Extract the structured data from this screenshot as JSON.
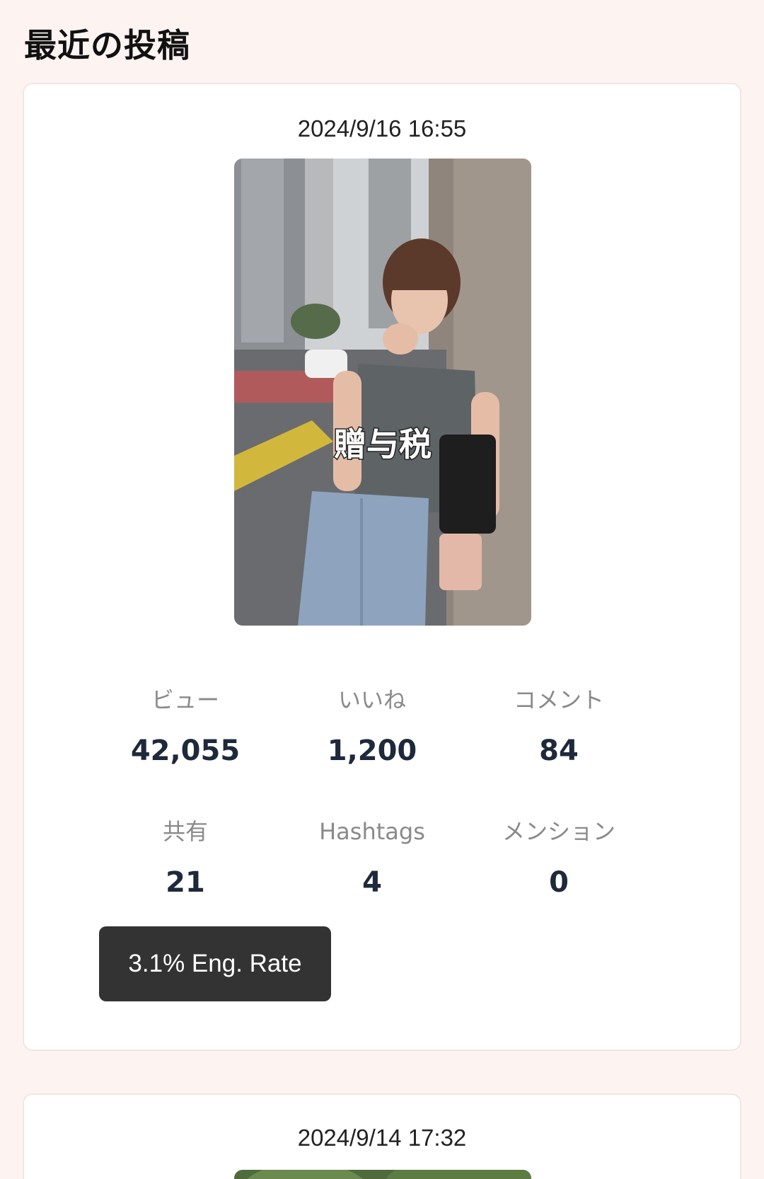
{
  "section": {
    "title": "最近の投稿"
  },
  "posts": [
    {
      "date": "2024/9/16 16:55",
      "thumbnail_caption": "贈与税",
      "stats": [
        {
          "label": "ビュー",
          "value": "42,055"
        },
        {
          "label": "いいね",
          "value": "1,200"
        },
        {
          "label": "コメント",
          "value": "84"
        },
        {
          "label": "共有",
          "value": "21"
        },
        {
          "label": "Hashtags",
          "value": "4"
        },
        {
          "label": "メンション",
          "value": "0"
        }
      ],
      "engagement": "3.1% Eng. Rate"
    },
    {
      "date": "2024/9/14 17:32"
    }
  ],
  "colors": {
    "background": "#fdf4f2",
    "card": "#ffffff",
    "stat_label": "#8a8a8a",
    "stat_value": "#1e2a3b",
    "badge": "#333333"
  }
}
